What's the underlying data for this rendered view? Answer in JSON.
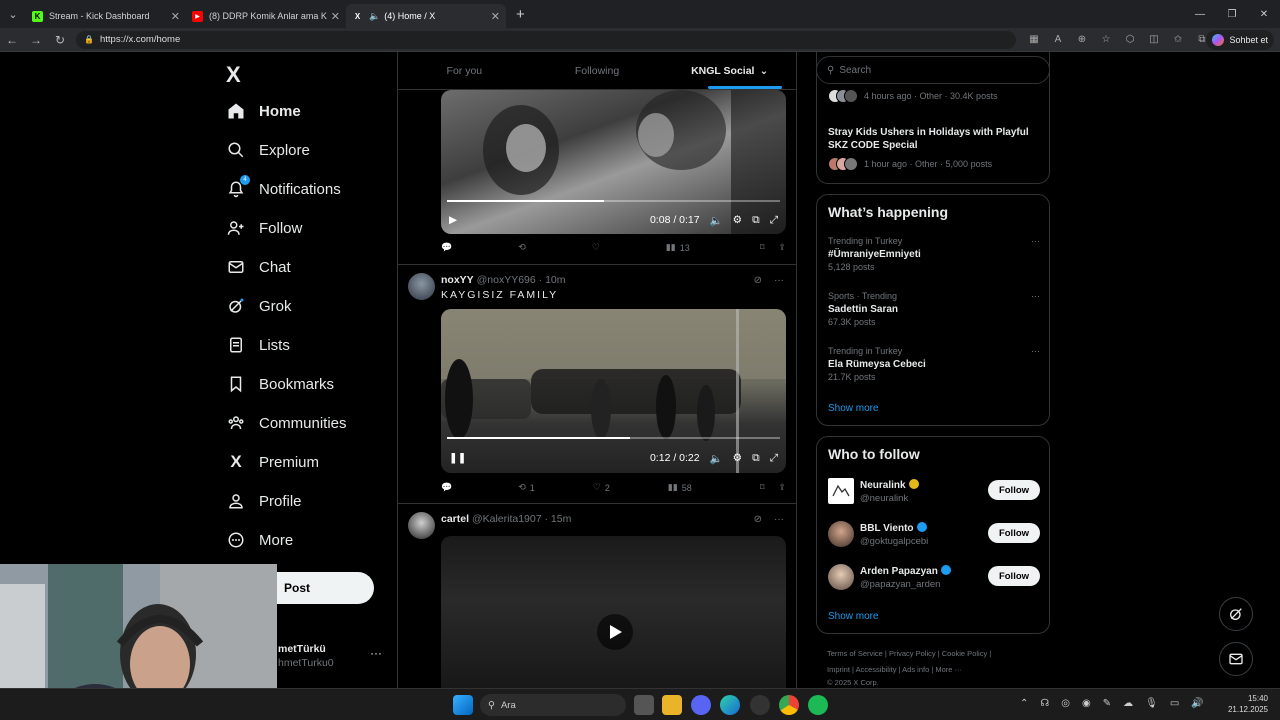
{
  "browser": {
    "tabs": [
      {
        "title": "Stream - Kick Dashboard",
        "favicon_color": "#53fc18",
        "favicon_letter": "K"
      },
      {
        "title": "(8) DDRP Komik Anlar ama Kick Cl",
        "favicon_color": "#ff0000",
        "favicon_letter": "▶"
      },
      {
        "title": "(4) Home / X",
        "favicon_color": "#ffffff",
        "favicon_letter": "X"
      }
    ],
    "url": "https://x.com/home",
    "copilot_label": "Sohbet et"
  },
  "sidebar": {
    "logo": "X",
    "items": [
      {
        "label": "Home"
      },
      {
        "label": "Explore"
      },
      {
        "label": "Notifications",
        "badge": "4"
      },
      {
        "label": "Follow"
      },
      {
        "label": "Chat"
      },
      {
        "label": "Grok"
      },
      {
        "label": "Lists"
      },
      {
        "label": "Bookmarks"
      },
      {
        "label": "Communities"
      },
      {
        "label": "Premium"
      },
      {
        "label": "Profile"
      },
      {
        "label": "More"
      }
    ],
    "post_label": "Post",
    "account_name": "metTürkü",
    "account_handle": "hmetTurku0"
  },
  "feed": {
    "tabs": [
      "For you",
      "Following",
      "KNGL Social"
    ],
    "video1": {
      "time": "0:08 / 0:17",
      "progress": 0.47
    },
    "actions1": {
      "replies": "",
      "reposts": "",
      "likes": "",
      "views": "13"
    },
    "tweet2": {
      "name": "noxYY",
      "handle": "@noxYY696",
      "time": "· 10m",
      "text": "KAYGISIZ FAMILY"
    },
    "video2": {
      "time": "0:12 / 0:22",
      "progress": 0.55
    },
    "actions2": {
      "replies": "",
      "reposts": "1",
      "likes": "2",
      "views": "58"
    },
    "tweet3": {
      "name": "cartel",
      "handle": "@Kalerita1907",
      "time": "· 15m"
    }
  },
  "right": {
    "search_placeholder": "Search",
    "trend_top_meta": "4 hours ago · Other · 30.4K posts",
    "stray_title": "Stray Kids Ushers in Holidays with Playful SKZ CODE Special",
    "stray_meta": "1 hour ago · Other · 5,000 posts",
    "happening_title": "What’s happening",
    "trends": [
      {
        "category": "Trending in Turkey",
        "name": "#ÜmraniyeEmniyeti",
        "count": "5,128 posts"
      },
      {
        "category": "Sports · Trending",
        "name": "Sadettin Saran",
        "count": "67.3K posts"
      },
      {
        "category": "Trending in Turkey",
        "name": "Ela Rümeysa Cebeci",
        "count": "21.7K posts"
      }
    ],
    "show_more": "Show more",
    "wtf_title": "Who to follow",
    "who_to_follow": [
      {
        "name": "Neuralink",
        "handle": "@neuralink",
        "verified_color": "#e2b719"
      },
      {
        "name": "BBL Viento",
        "handle": "@goktugalpcebi",
        "verified_color": "#1d9bf0"
      },
      {
        "name": "Arden Papazyan",
        "handle": "@papazyan_arden",
        "verified_color": "#1d9bf0"
      }
    ],
    "follow_label": "Follow",
    "show_more2": "Show more",
    "footer": {
      "line1": "Terms of Service  |  Privacy Policy  |  Cookie Policy  |",
      "line2": "Imprint  |  Accessibility  |  Ads info  |  More ···",
      "line3": "© 2025 X Corp."
    }
  },
  "taskbar": {
    "search_label": "Ara",
    "time": "15:40",
    "date": "21.12.2025"
  },
  "colors": {
    "accent": "#1d9bf0",
    "bg": "#000000",
    "border": "#2f3336"
  }
}
